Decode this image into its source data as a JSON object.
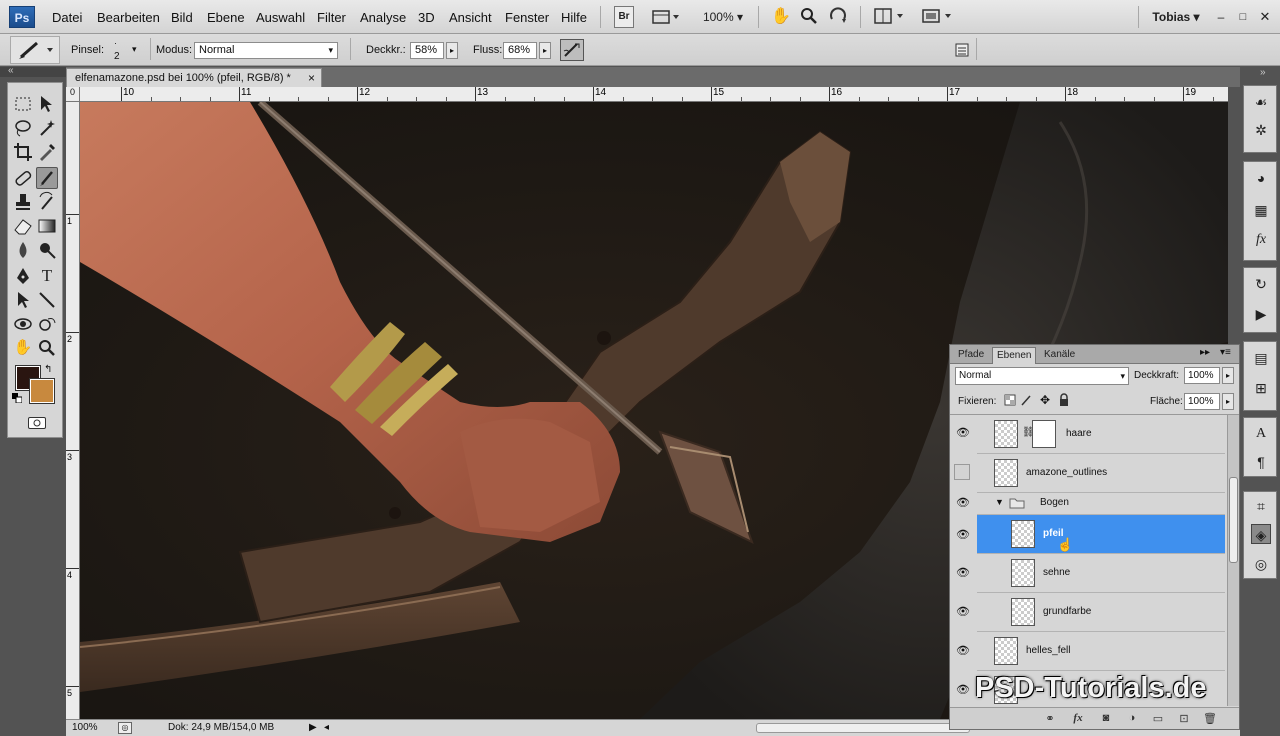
{
  "app": {
    "logo": "Ps"
  },
  "menu": [
    "Datei",
    "Bearbeiten",
    "Bild",
    "Ebene",
    "Auswahl",
    "Filter",
    "Analyse",
    "3D",
    "Ansicht",
    "Fenster",
    "Hilfe"
  ],
  "appbar": {
    "bridge_label": "Br",
    "zoom": "100%",
    "user": "Tobias"
  },
  "options": {
    "brush_label": "Pinsel:",
    "brush_size": "2",
    "mode_label": "Modus:",
    "mode_value": "Normal",
    "opacity_label": "Deckkr.:",
    "opacity_value": "58%",
    "flow_label": "Fluss:",
    "flow_value": "68%"
  },
  "document": {
    "tab_title": "elfenamazone.psd bei 100% (pfeil, RGB/8) *",
    "close": "×"
  },
  "ruler": {
    "top": [
      "10",
      "11",
      "12",
      "13",
      "14",
      "15",
      "16",
      "17",
      "18",
      "19"
    ],
    "left": [
      "1",
      "2",
      "3",
      "4",
      "5"
    ],
    "origin": "0"
  },
  "colors": {
    "foreground": "#2a1510",
    "background": "#c8893e",
    "accent": "#3f90ee"
  },
  "status": {
    "zoom": "100%",
    "doc_info": "Dok: 24,9 MB/154,0 MB"
  },
  "layers_panel": {
    "tabs": [
      "Pfade",
      "Ebenen",
      "Kanäle"
    ],
    "blend_mode": "Normal",
    "opacity_label": "Deckkraft:",
    "opacity_value": "100%",
    "lock_label": "Fixieren:",
    "fill_label": "Fläche:",
    "fill_value": "100%",
    "layers": [
      {
        "name": "haare",
        "visible": true,
        "has_mask": true
      },
      {
        "name": "amazone_outlines",
        "visible": false
      },
      {
        "name": "Bogen",
        "visible": true,
        "group": true
      },
      {
        "name": "pfeil",
        "visible": true,
        "selected": true
      },
      {
        "name": "sehne",
        "visible": true
      },
      {
        "name": "grundfarbe",
        "visible": true
      },
      {
        "name": "helles_fell",
        "visible": true
      }
    ]
  },
  "watermark": "PSD-Tutorials.de"
}
